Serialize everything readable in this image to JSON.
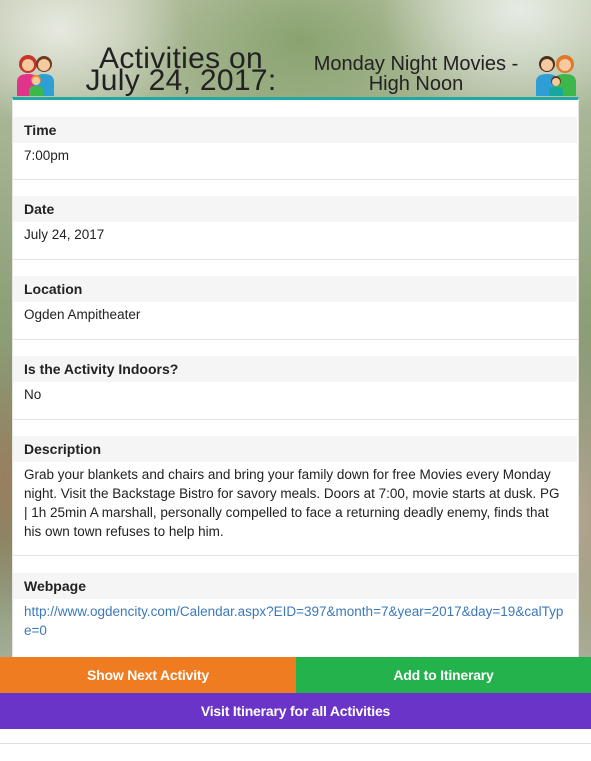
{
  "header": {
    "title": "Activities on July 24, 2017:",
    "activity_name": "Monday Night Movies - High Noon",
    "left_icon": "family-icon",
    "right_icon": "family-icon"
  },
  "details": {
    "time": {
      "label": "Time",
      "value": "7:00pm"
    },
    "date": {
      "label": "Date",
      "value": "July 24, 2017"
    },
    "location": {
      "label": "Location",
      "value": "Ogden Ampitheater"
    },
    "indoors": {
      "label": "Is the Activity Indoors?",
      "value": "No"
    },
    "description": {
      "label": "Description",
      "value": "Grab your blankets and chairs and bring your family down for free Movies every Monday night. Visit the Backstage Bistro for savory meals. Doors at 7:00, movie starts at dusk. PG | 1h 25min A marshall, personally compelled to face a returning deadly enemy, finds that his own town refuses to help him."
    },
    "webpage": {
      "label": "Webpage",
      "value": "http://www.ogdencity.com/Calendar.aspx?EID=397&month=7&year=2017&day=19&calType=0"
    }
  },
  "actions": {
    "next_label": "Show Next Activity",
    "add_label": "Add to Itinerary",
    "visit_label": "Visit Itinerary for all Activities"
  },
  "colors": {
    "accent": "#1fa9a2",
    "next": "#f07c22",
    "add": "#23b24b",
    "visit": "#6b34c8",
    "link": "#3c79b8"
  }
}
